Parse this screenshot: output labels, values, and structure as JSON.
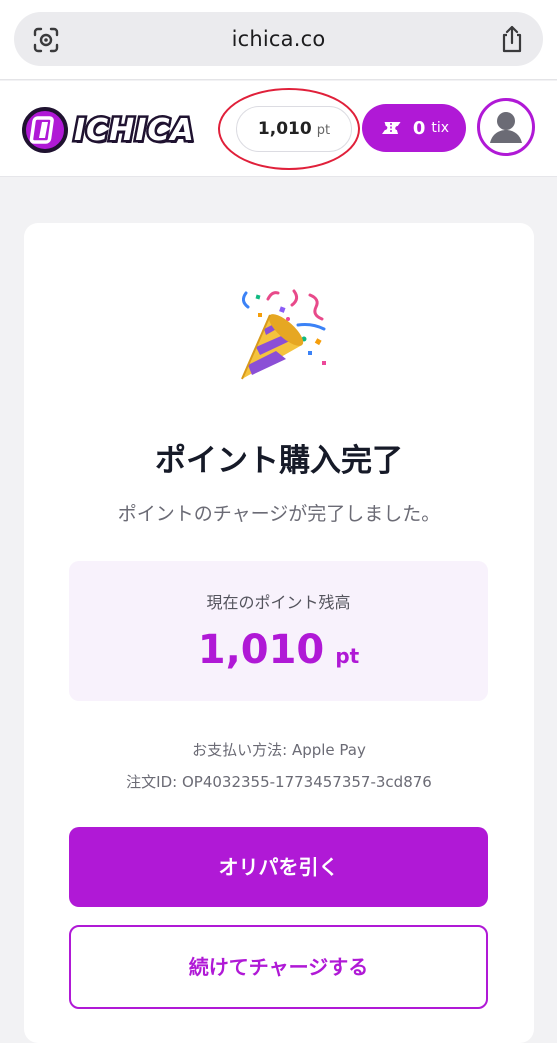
{
  "browser": {
    "url": "ichica.co"
  },
  "header": {
    "logo_text": "ICHICA",
    "points_value": "1,010",
    "points_unit": "pt",
    "tix_value": "0",
    "tix_unit": "tix"
  },
  "card": {
    "title": "ポイント購入完了",
    "subtitle": "ポイントのチャージが完了しました。",
    "balance_label": "現在のポイント残高",
    "balance_value": "1,010",
    "balance_unit": "pt",
    "payment_method": "お支払い方法: Apple Pay",
    "order_id": "注文ID: OP4032355-1773457357-3cd876",
    "primary_button": "オリパを引く",
    "secondary_button": "続けてチャージする"
  },
  "colors": {
    "accent": "#b019d6",
    "highlight_ring": "#e0203a",
    "title_text": "#161a28",
    "balance_bg": "#f8f2fc"
  },
  "icons": [
    "lens-icon",
    "share-icon",
    "logo-icon",
    "ticket-icon",
    "avatar-icon",
    "party-popper-icon"
  ]
}
